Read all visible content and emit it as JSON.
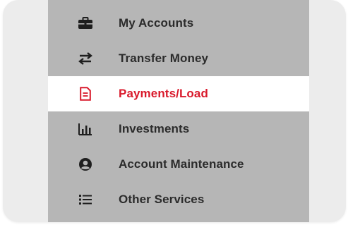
{
  "menu": {
    "items": [
      {
        "label": "My Accounts",
        "icon": "briefcase-icon"
      },
      {
        "label": "Transfer Money",
        "icon": "transfer-arrows-icon"
      },
      {
        "label": "Payments/Load",
        "icon": "document-icon",
        "active": true
      },
      {
        "label": "Investments",
        "icon": "bar-chart-icon"
      },
      {
        "label": "Account Maintenance",
        "icon": "user-circle-icon"
      },
      {
        "label": "Other Services",
        "icon": "list-icon"
      }
    ]
  },
  "colors": {
    "menu_bg": "#b6b6b6",
    "active_bg": "#ffffff",
    "active_text": "#d9192b",
    "text": "#2b2b2b"
  }
}
